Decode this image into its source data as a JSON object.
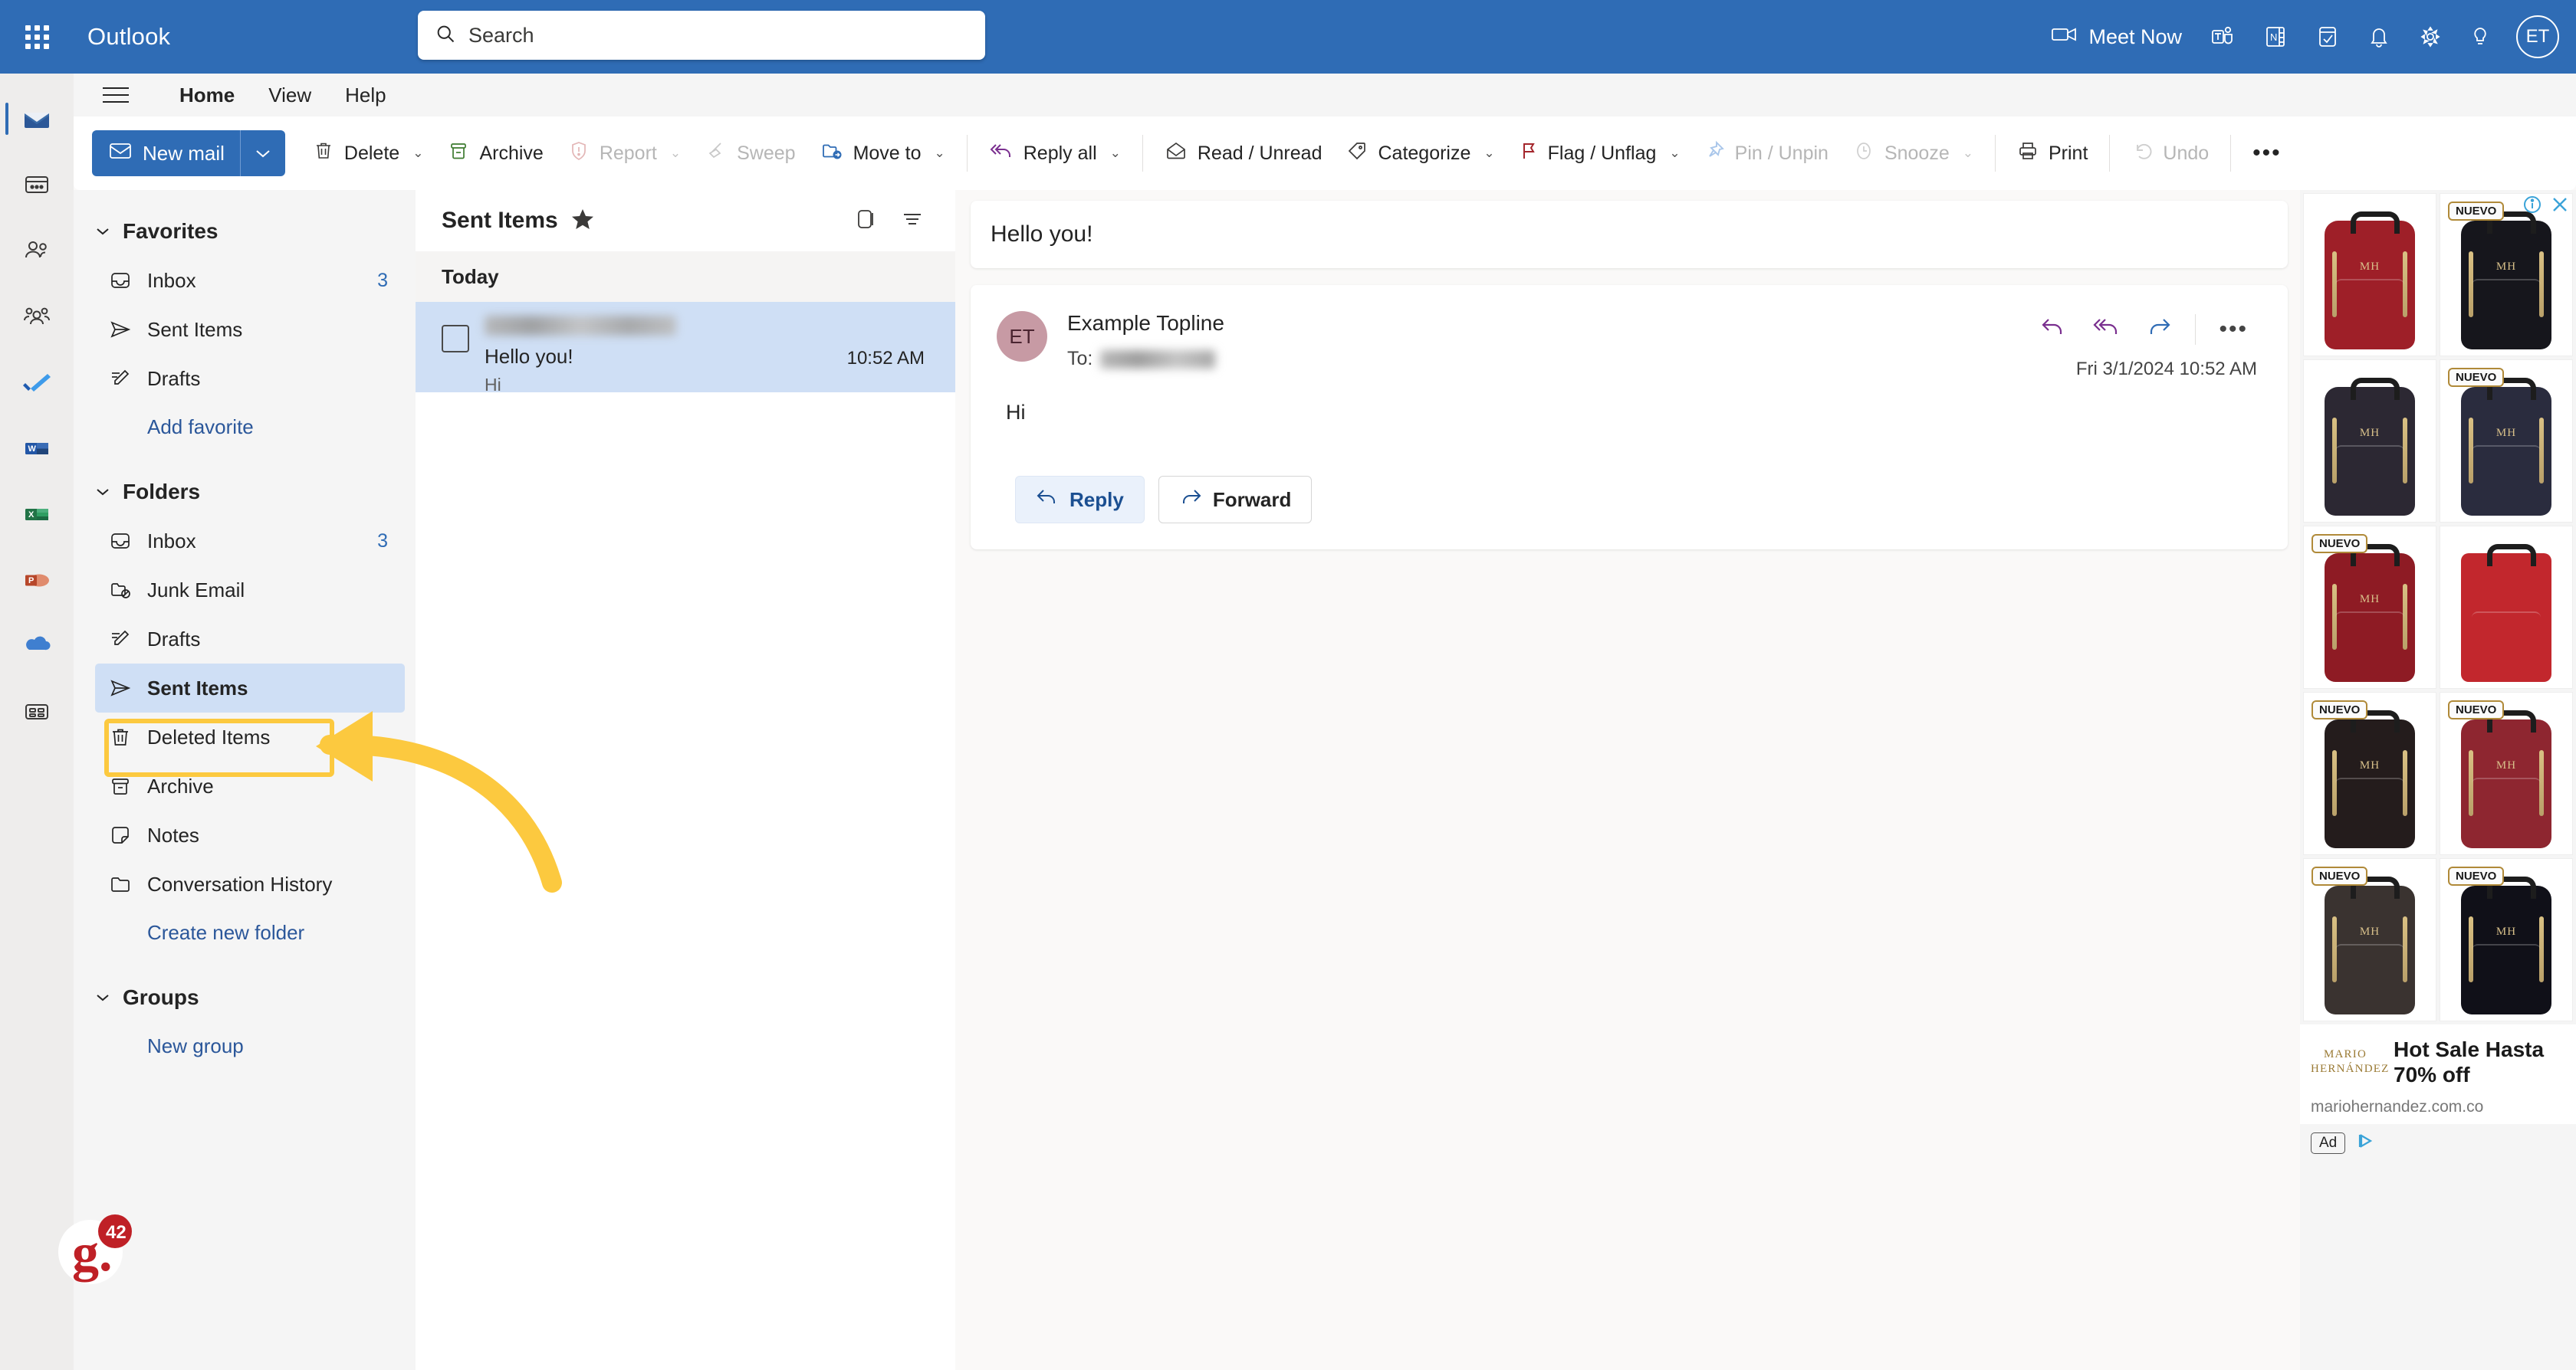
{
  "topbar": {
    "app_launcher": "app-launcher",
    "brand": "Outlook",
    "search_placeholder": "Search",
    "meet_now": "Meet Now",
    "avatar_initials": "ET",
    "icons": [
      "teams-icon",
      "onenote-icon",
      "todo-icon",
      "notifications-bell-icon",
      "settings-gear-icon",
      "tips-lightbulb-icon"
    ]
  },
  "rail": {
    "items": [
      {
        "name": "mail",
        "label": "Mail",
        "active": true
      },
      {
        "name": "calendar",
        "label": "Calendar",
        "active": false
      },
      {
        "name": "people",
        "label": "People",
        "active": false
      },
      {
        "name": "groups",
        "label": "Groups",
        "active": false
      },
      {
        "name": "todo",
        "label": "To Do",
        "active": false
      },
      {
        "name": "word",
        "label": "Word",
        "active": false
      },
      {
        "name": "excel",
        "label": "Excel",
        "active": false
      },
      {
        "name": "powerpoint",
        "label": "PowerPoint",
        "active": false
      },
      {
        "name": "onedrive",
        "label": "OneDrive",
        "active": false
      },
      {
        "name": "all-apps",
        "label": "All apps",
        "active": false
      }
    ]
  },
  "ribbon": {
    "tabs": [
      {
        "label": "Home",
        "selected": true
      },
      {
        "label": "View",
        "selected": false
      },
      {
        "label": "Help",
        "selected": false
      }
    ],
    "new_mail": "New mail",
    "buttons": [
      {
        "label": "Delete",
        "icon": "trash-icon",
        "caret": true,
        "disabled": false
      },
      {
        "label": "Archive",
        "icon": "archive-box-icon",
        "caret": false,
        "disabled": false
      },
      {
        "label": "Report",
        "icon": "report-shield-icon",
        "caret": true,
        "disabled": true
      },
      {
        "label": "Sweep",
        "icon": "sweep-broom-icon",
        "caret": false,
        "disabled": true
      },
      {
        "label": "Move to",
        "icon": "move-folder-icon",
        "caret": true,
        "disabled": false
      },
      {
        "label": "Reply all",
        "icon": "reply-all-icon",
        "caret": true,
        "disabled": false
      },
      {
        "label": "Read / Unread",
        "icon": "envelope-open-icon",
        "caret": false,
        "disabled": false
      },
      {
        "label": "Categorize",
        "icon": "tag-icon",
        "caret": true,
        "disabled": false
      },
      {
        "label": "Flag / Unflag",
        "icon": "flag-icon",
        "caret": true,
        "disabled": false
      },
      {
        "label": "Pin / Unpin",
        "icon": "pin-icon",
        "caret": false,
        "disabled": true
      },
      {
        "label": "Snooze",
        "icon": "clock-icon",
        "caret": true,
        "disabled": true
      },
      {
        "label": "Print",
        "icon": "printer-icon",
        "caret": false,
        "disabled": false
      },
      {
        "label": "Undo",
        "icon": "undo-arrow-icon",
        "caret": false,
        "disabled": true
      },
      {
        "label": "•••",
        "icon": "more-options-icon",
        "caret": false,
        "disabled": false
      }
    ]
  },
  "sidebar": {
    "favorites": {
      "title": "Favorites",
      "items": [
        {
          "label": "Inbox",
          "icon": "inbox-icon",
          "count": "3"
        },
        {
          "label": "Sent Items",
          "icon": "send-icon",
          "count": ""
        },
        {
          "label": "Drafts",
          "icon": "draft-pencil-icon",
          "count": ""
        }
      ],
      "add_link": "Add favorite"
    },
    "folders": {
      "title": "Folders",
      "items": [
        {
          "label": "Inbox",
          "icon": "inbox-icon",
          "count": "3",
          "selected": false
        },
        {
          "label": "Junk Email",
          "icon": "junk-folder-icon",
          "count": "",
          "selected": false
        },
        {
          "label": "Drafts",
          "icon": "draft-pencil-icon",
          "count": "",
          "selected": false
        },
        {
          "label": "Sent Items",
          "icon": "send-icon",
          "count": "",
          "selected": true
        },
        {
          "label": "Deleted Items",
          "icon": "trash-icon",
          "count": "",
          "selected": false
        },
        {
          "label": "Archive",
          "icon": "archive-box-icon",
          "count": "",
          "selected": false
        },
        {
          "label": "Notes",
          "icon": "note-icon",
          "count": "",
          "selected": false
        },
        {
          "label": "Conversation History",
          "icon": "folder-icon",
          "count": "",
          "selected": false
        }
      ],
      "create_link": "Create new folder"
    },
    "groups": {
      "title": "Groups",
      "new_link": "New group"
    }
  },
  "message_list": {
    "title": "Sent Items",
    "pinned_icon": "star-filled-icon",
    "toolbar_icons": [
      "reading-pane-toggle-icon",
      "filter-icon"
    ],
    "day_group": "Today",
    "messages": [
      {
        "sender": "",
        "sender_redacted": true,
        "subject": "Hello you!",
        "preview": "Hi",
        "time": "10:52 AM",
        "selected": true
      }
    ]
  },
  "reading_pane": {
    "subject": "Hello you!",
    "avatar_initials": "ET",
    "from_name": "Example Topline",
    "to_label": "To:",
    "to_redacted": true,
    "date": "Fri 3/1/2024 10:52 AM",
    "body": "Hi",
    "actions": [
      "reply-icon",
      "reply-all-icon",
      "forward-icon",
      "more-options-icon"
    ],
    "reply_button": "Reply",
    "forward_button": "Forward"
  },
  "ad_panel": {
    "info_icon": "ad-info-icon",
    "close_icon": "close-icon",
    "badge_label": "NUEVO",
    "brand": "MARIO HERNÁNDEZ",
    "brand_line1": "MARIO",
    "brand_line2": "HERNÁNDEZ",
    "headline": "Hot Sale Hasta 70% off",
    "url": "mariohernandez.com.co",
    "ad_chip": "Ad",
    "products": [
      {
        "color": "#9e1f28",
        "badge": false
      },
      {
        "color": "#16161c",
        "badge": true
      },
      {
        "color": "#2c2833",
        "badge": false
      },
      {
        "color": "#2a2c3e",
        "badge": true
      },
      {
        "color": "#8e1b24",
        "badge": true
      },
      {
        "color": "#c2272d",
        "badge": false
      },
      {
        "color": "#241c1c",
        "badge": true
      },
      {
        "color": "#8e2630",
        "badge": true
      },
      {
        "color": "#3a3330",
        "badge": true
      },
      {
        "color": "#101018",
        "badge": true
      }
    ]
  },
  "annotation": {
    "highlight_target": "Sent Items",
    "arrow_color": "#fcc93f"
  },
  "watermark": {
    "logo_text": "g.",
    "badge_count": "42"
  }
}
